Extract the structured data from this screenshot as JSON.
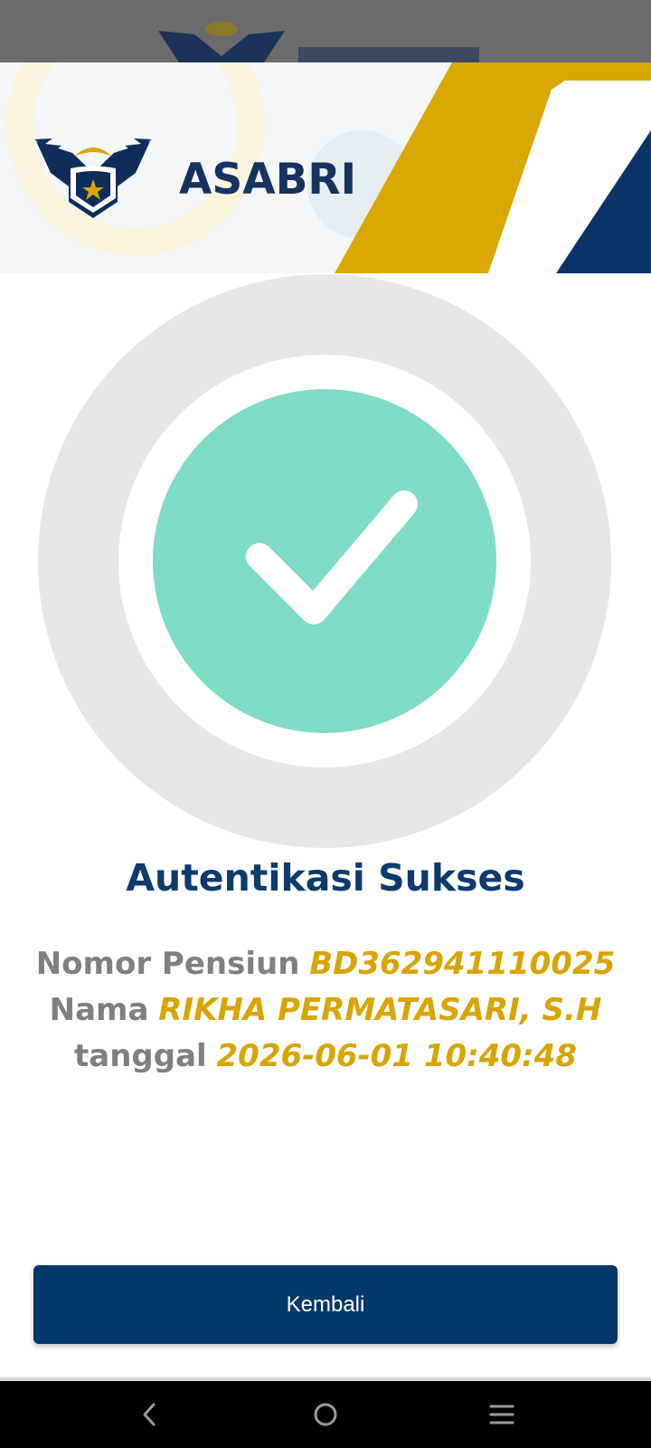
{
  "header": {
    "brand_name": "ASABRI"
  },
  "status": {
    "title": "Autentikasi Sukses"
  },
  "details": {
    "pension_label": "Nomor Pensiun",
    "pension_value": "BD362941110025",
    "name_label": "Nama",
    "name_value": "RIKHA PERMATASARI, S.H",
    "date_label": "tanggal",
    "date_value": "2026-06-01 10:40:48"
  },
  "actions": {
    "back_label": "Kembali"
  },
  "navbar": {
    "back_icon": "chevron-left-icon",
    "home_icon": "circle-home-icon",
    "menu_icon": "hamburger-menu-icon"
  },
  "colors": {
    "primary_navy": "#04386a",
    "accent_gold": "#d7a400",
    "success_teal": "#7edbc6"
  }
}
